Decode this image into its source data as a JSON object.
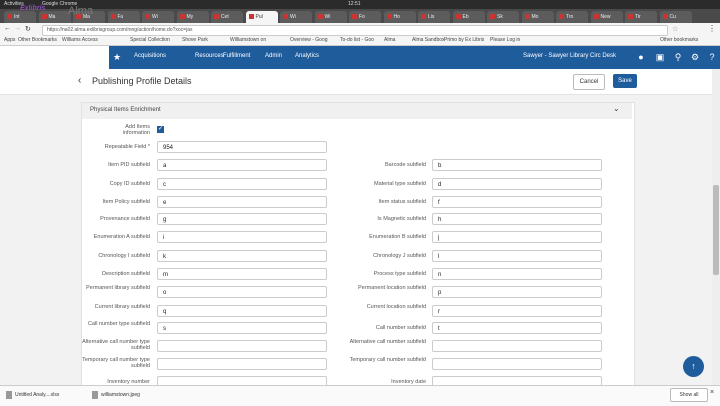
{
  "os": {
    "activities": "Activities",
    "app": "Google Chrome",
    "time": "12:51"
  },
  "tabs": [
    "Int",
    "Ma",
    "Ma",
    "Fu",
    "Wi",
    "My",
    "Cet",
    "Pul",
    "Wi",
    "Wi",
    "Fo",
    "Ho",
    "Lis",
    "Eb",
    "Sk",
    "Mo",
    "Tro",
    "New",
    "Tir",
    "Cu"
  ],
  "address": {
    "url": "https://na02.alma.exlibrisgroup.com/mng/action/home.do?xoc=jax"
  },
  "bookmarks": [
    "Apps",
    "Other Bookmarks",
    "Williams Access",
    "Special Collection",
    "Shove Park",
    "Williamstown on",
    "Overview - Goog",
    "To-do list - Goo",
    "Alma",
    "Alma Sandbox",
    "Primo by Ex Libris",
    "Please Log in",
    "Other bookmarks"
  ],
  "header": {
    "exlibris": "Exlibris",
    "alma": "Alma",
    "nav": [
      "Acquisitions",
      "Resources",
      "Fulfillment",
      "Admin",
      "Analytics"
    ],
    "user": "Sawyer - Sawyer Library Circ Desk"
  },
  "page": {
    "title": "Publishing Profile Details",
    "cancel": "Cancel",
    "save": "Save"
  },
  "section": {
    "title": "Physical Items Enrichment"
  },
  "form": {
    "add_items_label": "Add Items information",
    "repeatable_label": "Repeatable Field *",
    "repeatable_value": "954",
    "rows": [
      {
        "l1": "Item PID subfield",
        "v1": "a",
        "l2": "Barcode subfield",
        "v2": "b"
      },
      {
        "l1": "Copy ID subfield",
        "v1": "c",
        "l2": "Material type subfield",
        "v2": "d"
      },
      {
        "l1": "Item Policy subfield",
        "v1": "e",
        "l2": "Item status subfield",
        "v2": "f"
      },
      {
        "l1": "Provenance subfield",
        "v1": "g",
        "l2": "Is Magnetic subfield",
        "v2": "h"
      },
      {
        "l1": "Enumeration A subfield",
        "v1": "i",
        "l2": "Enumeration B subfield",
        "v2": "j"
      },
      {
        "l1": "Chronology I subfield",
        "v1": "k",
        "l2": "Chronology J subfield",
        "v2": "l"
      },
      {
        "l1": "Description subfield",
        "v1": "m",
        "l2": "Process type subfield",
        "v2": "n"
      },
      {
        "l1": "Permanent library subfield",
        "v1": "o",
        "l2": "Permanent location subfield",
        "v2": "p"
      },
      {
        "l1": "Current library subfield",
        "v1": "q",
        "l2": "Current location subfield",
        "v2": "r"
      },
      {
        "l1": "Call number type subfield",
        "v1": "s",
        "l2": "Call number subfield",
        "v2": "t"
      },
      {
        "l1": "Alternative call number type subfield",
        "v1": "",
        "l2": "Alternative call number subfield",
        "v2": ""
      },
      {
        "l1": "Temporary call number type subfield",
        "v1": "",
        "l2": "Temporary call number subfield",
        "v2": ""
      },
      {
        "l1": "Inventory number",
        "v1": "",
        "l2": "Inventory date",
        "v2": ""
      }
    ]
  },
  "downloads": [
    "Untitled Analy....xlsx",
    "williamstown.jpeg"
  ],
  "show_all": "Show all",
  "colors": {
    "nav_blue": "#1f5c9c",
    "exlibris_purple": "#8b4fb8"
  }
}
